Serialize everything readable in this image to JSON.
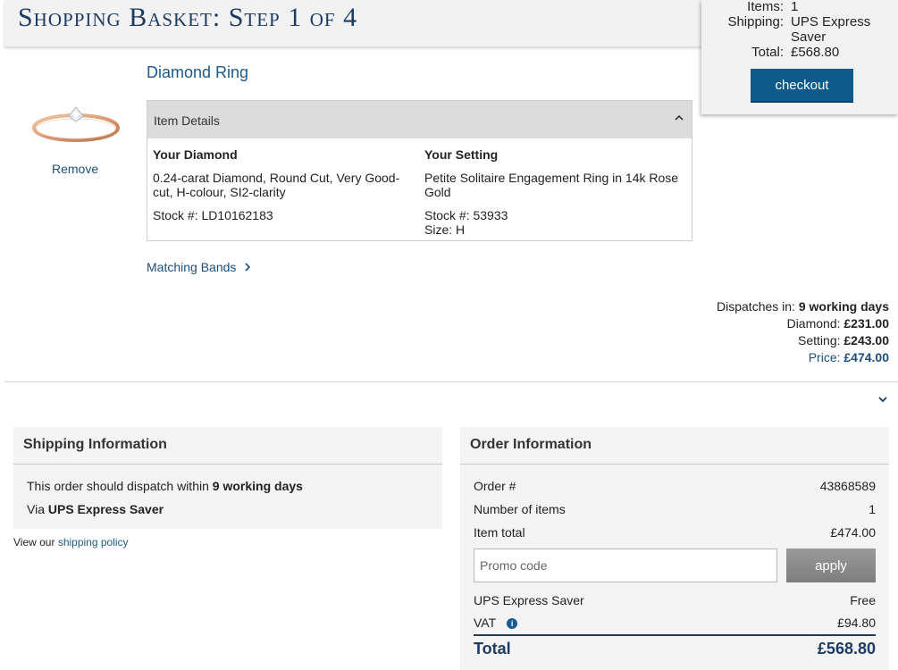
{
  "page": {
    "title": "Shopping Basket: Step 1 of 4"
  },
  "summary": {
    "items_label": "Items:",
    "items_value": "1",
    "shipping_label": "Shipping:",
    "shipping_value_line1": "UPS Express",
    "shipping_value_line2": "Saver",
    "total_label": "Total:",
    "total_value": "£568.80",
    "checkout_label": "checkout"
  },
  "item": {
    "title": "Diamond Ring",
    "remove_label": "Remove",
    "details_label": "Item Details",
    "diamond": {
      "heading": "Your Diamond",
      "description": "0.24-carat Diamond, Round Cut, Very Good-cut, H-colour, SI2-clarity",
      "stock": "Stock #: LD10162183"
    },
    "setting": {
      "heading": "Your Setting",
      "description": "Petite Solitaire Engagement Ring in 14k Rose Gold",
      "stock": "Stock #: 53933",
      "size": "Size: H"
    },
    "matching_bands_label": "Matching Bands"
  },
  "pricing": {
    "dispatch_label": "Dispatches in:",
    "dispatch_value": "9 working days",
    "diamond_label": "Diamond:",
    "diamond_value": "£231.00",
    "setting_label": "Setting:",
    "setting_value": "£243.00",
    "price_label": "Price:",
    "price_value": "£474.00"
  },
  "shipping_info": {
    "heading": "Shipping Information",
    "dispatch_prefix": "This order should dispatch within",
    "dispatch_value": "9 working days",
    "via_prefix": "Via",
    "via_value": "UPS Express Saver",
    "policy_prefix": "View our",
    "policy_link": "shipping policy"
  },
  "order_info": {
    "heading": "Order Information",
    "order_no_label": "Order #",
    "order_no_value": "43868589",
    "num_items_label": "Number of items",
    "num_items_value": "1",
    "item_total_label": "Item total",
    "item_total_value": "£474.00",
    "promo_placeholder": "Promo code",
    "apply_label": "apply",
    "shipping_label": "UPS Express Saver",
    "shipping_value": "Free",
    "vat_label": "VAT",
    "vat_value": "£94.80",
    "total_label": "Total",
    "total_value": "£568.80"
  },
  "colors": {
    "navy": "#1d3b63",
    "link_blue": "#1d5a8c",
    "checkout_blue": "#0c5a8c",
    "panel_grey": "#f4f4f4"
  }
}
